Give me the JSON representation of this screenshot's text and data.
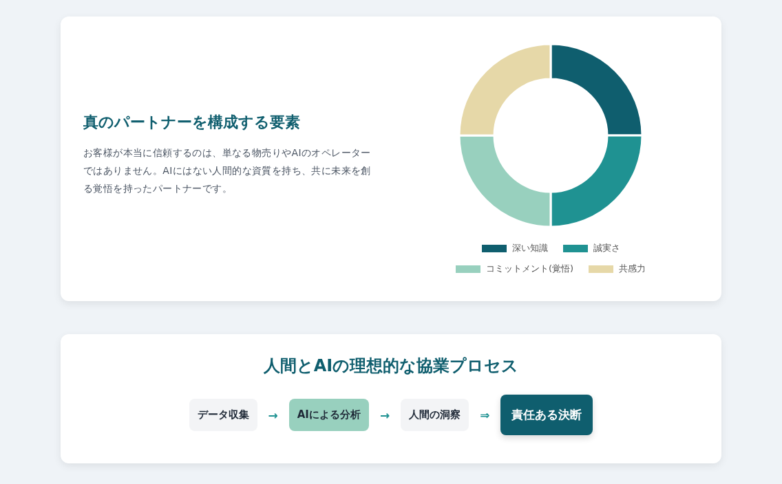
{
  "partner_card": {
    "title": "真のパートナーを構成する要素",
    "description": "お客様が本当に信頼するのは、単なる物売りやAIのオペレーターではありません。AIにはない人間的な資質を持ち、共に未来を創る覚悟を持ったパートナーです。",
    "legend": [
      {
        "label": "深い知識",
        "color": "#0f5e6e"
      },
      {
        "label": "誠実さ",
        "color": "#1f9292"
      },
      {
        "label": "コミットメント(覚悟)",
        "color": "#98d0be"
      },
      {
        "label": "共感力",
        "color": "#e6d8a8"
      }
    ]
  },
  "process_card": {
    "title": "人間とAIの理想的な協業プロセス",
    "steps": [
      {
        "label": "データ収集",
        "kind": "plain"
      },
      {
        "label": "→",
        "kind": "arrow"
      },
      {
        "label": "AIによる分析",
        "kind": "ai"
      },
      {
        "label": "→",
        "kind": "arrow"
      },
      {
        "label": "人間の洞察",
        "kind": "plain"
      },
      {
        "label": "⇒",
        "kind": "arrow"
      },
      {
        "label": "責任ある決断",
        "kind": "final"
      }
    ]
  }
}
